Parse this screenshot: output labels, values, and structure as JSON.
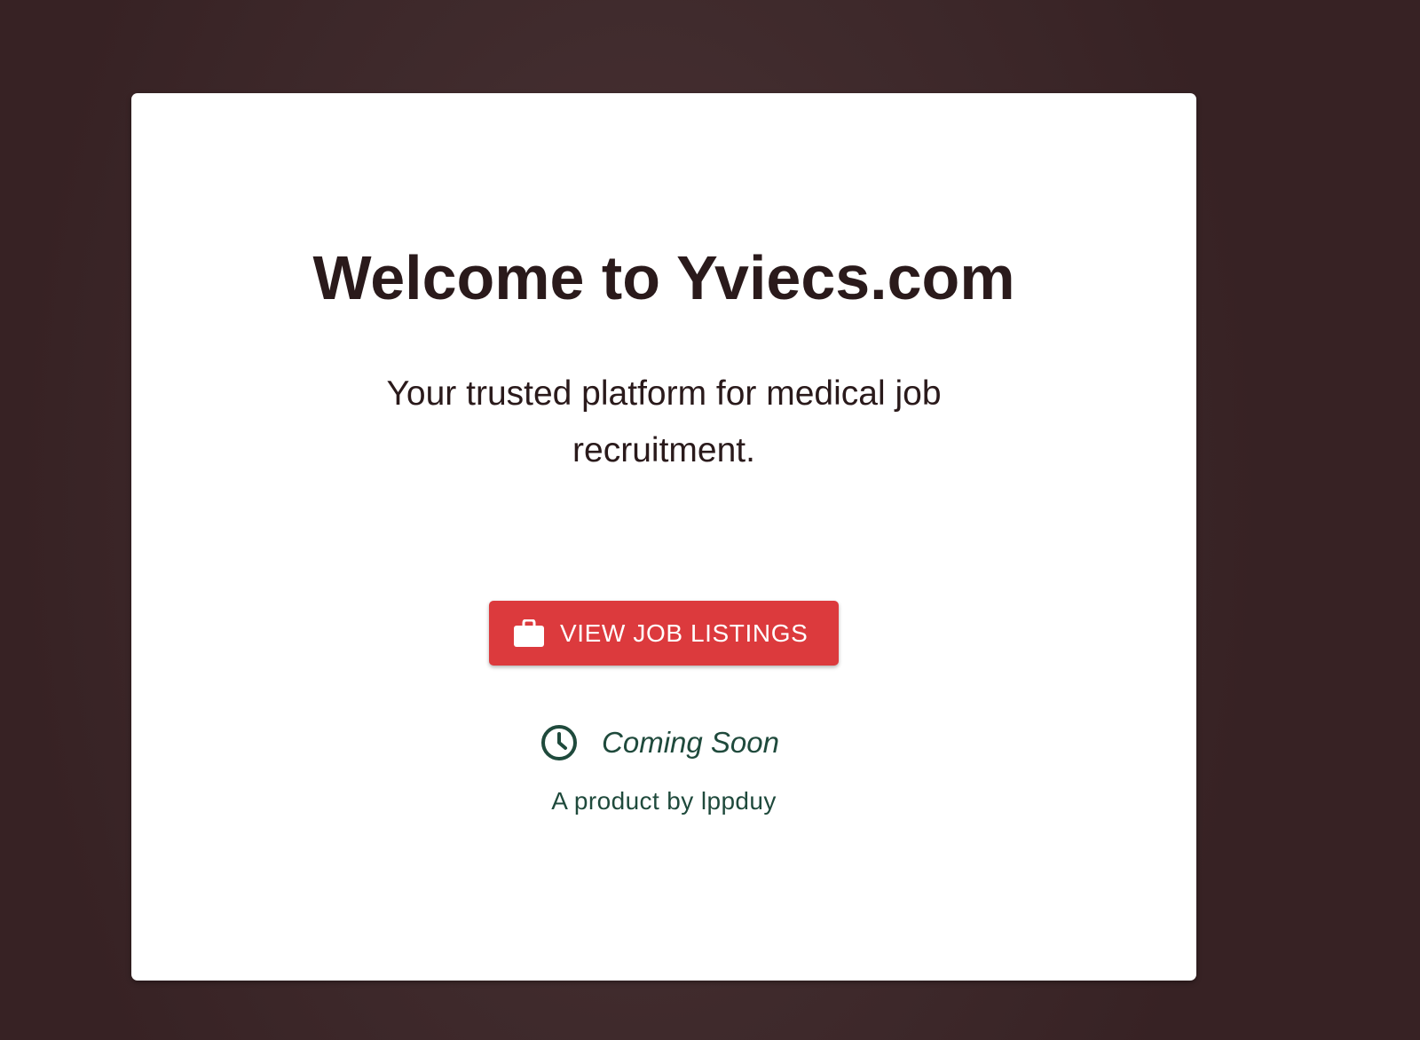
{
  "hero": {
    "title": "Welcome to Yviecs.com",
    "subtitle": "Your trusted platform for medical job recruitment."
  },
  "cta": {
    "label": "VIEW JOB LISTINGS",
    "icon": "briefcase-icon"
  },
  "status": {
    "text": "Coming Soon",
    "icon": "clock-icon"
  },
  "footer": {
    "credit": "A product by lppduy"
  },
  "colors": {
    "background": "#3f2a2c",
    "card": "#ffffff",
    "title_text": "#2a1a1b",
    "button": "#dc3a3d",
    "accent_green": "#1f4a3c"
  }
}
